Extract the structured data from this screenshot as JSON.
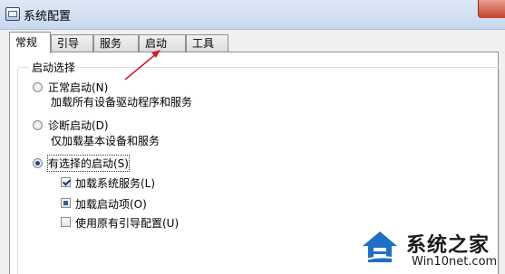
{
  "window": {
    "title": "系统配置"
  },
  "tabs": [
    {
      "label": "常规",
      "active": true
    },
    {
      "label": "引导",
      "active": false
    },
    {
      "label": "服务",
      "active": false
    },
    {
      "label": "启动",
      "active": false
    },
    {
      "label": "工具",
      "active": false
    }
  ],
  "startup_selection": {
    "legend": "启动选择",
    "options": [
      {
        "label": "正常启动(N)",
        "description": "加载所有设备驱动程序和服务",
        "selected": false
      },
      {
        "label": "诊断启动(D)",
        "description": "仅加载基本设备和服务",
        "selected": false
      },
      {
        "label": "有选择的启动(S)",
        "selected": true
      }
    ],
    "selective_items": [
      {
        "label": "加载系统服务(L)",
        "state": "checked"
      },
      {
        "label": "加载启动项(O)",
        "state": "indeterminate"
      },
      {
        "label": "使用原有引导配置(U)",
        "state": "unchecked"
      }
    ]
  },
  "watermark": {
    "brand": "系统之家",
    "url": "Win10net.com"
  },
  "colors": {
    "accent": "#1d4a82",
    "annotation_arrow": "#d0182a",
    "watermark_blue": "#1f6fc6"
  }
}
